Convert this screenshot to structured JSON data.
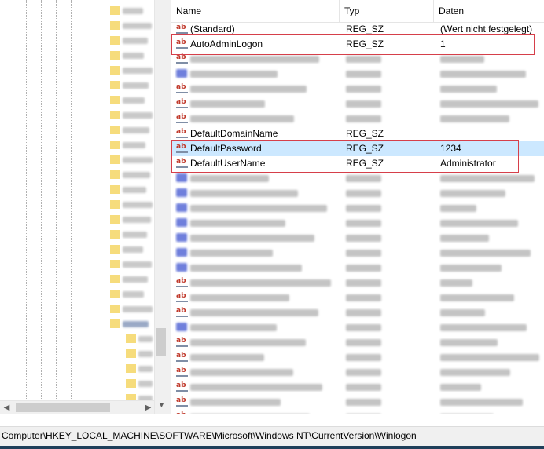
{
  "columns": {
    "name": "Name",
    "type": "Typ",
    "data": "Daten"
  },
  "rows": [
    {
      "icon": "string-value-icon",
      "name": "(Standard)",
      "type": "REG_SZ",
      "data": "(Wert nicht festgelegt)",
      "clear": true
    },
    {
      "icon": "string-value-icon",
      "name": "AutoAdminLogon",
      "type": "REG_SZ",
      "data": "1",
      "clear": true,
      "highlight": true
    },
    {
      "icon": "string-value-icon",
      "clear": false
    },
    {
      "icon": "binary-value-icon",
      "clear": false
    },
    {
      "icon": "string-value-icon",
      "clear": false
    },
    {
      "icon": "string-value-icon",
      "clear": false
    },
    {
      "icon": "string-value-icon",
      "clear": false
    },
    {
      "icon": "string-value-icon",
      "name": "DefaultDomainName",
      "type": "REG_SZ",
      "data": "",
      "clear": true
    },
    {
      "icon": "string-value-icon",
      "name": "DefaultPassword",
      "type": "REG_SZ",
      "data": "1234",
      "clear": true,
      "selected": true
    },
    {
      "icon": "string-value-icon",
      "name": "DefaultUserName",
      "type": "REG_SZ",
      "data": "Administrator",
      "clear": true
    },
    {
      "icon": "binary-value-icon",
      "clear": false
    },
    {
      "icon": "binary-value-icon",
      "clear": false
    },
    {
      "icon": "binary-value-icon",
      "clear": false
    },
    {
      "icon": "binary-value-icon",
      "clear": false
    },
    {
      "icon": "binary-value-icon",
      "clear": false
    },
    {
      "icon": "binary-value-icon",
      "clear": false
    },
    {
      "icon": "binary-value-icon",
      "clear": false
    },
    {
      "icon": "string-value-icon",
      "clear": false
    },
    {
      "icon": "string-value-icon",
      "clear": false
    },
    {
      "icon": "string-value-icon",
      "clear": false
    },
    {
      "icon": "binary-value-icon",
      "clear": false
    },
    {
      "icon": "string-value-icon",
      "clear": false
    },
    {
      "icon": "string-value-icon",
      "clear": false
    },
    {
      "icon": "string-value-icon",
      "clear": false
    },
    {
      "icon": "string-value-icon",
      "clear": false
    },
    {
      "icon": "string-value-icon",
      "clear": false
    },
    {
      "icon": "string-value-icon",
      "clear": false
    },
    {
      "icon": "string-value-icon",
      "clear": false
    }
  ],
  "status_path": "Computer\\HKEY_LOCAL_MACHINE\\SOFTWARE\\Microsoft\\Windows NT\\CurrentVersion\\Winlogon",
  "colors": {
    "highlight_border": "#d63f4a",
    "selection": "#cce8ff",
    "folder": "#f6dc7c",
    "string_icon": "#c0392b",
    "binary_icon": "#6f7fdc"
  }
}
